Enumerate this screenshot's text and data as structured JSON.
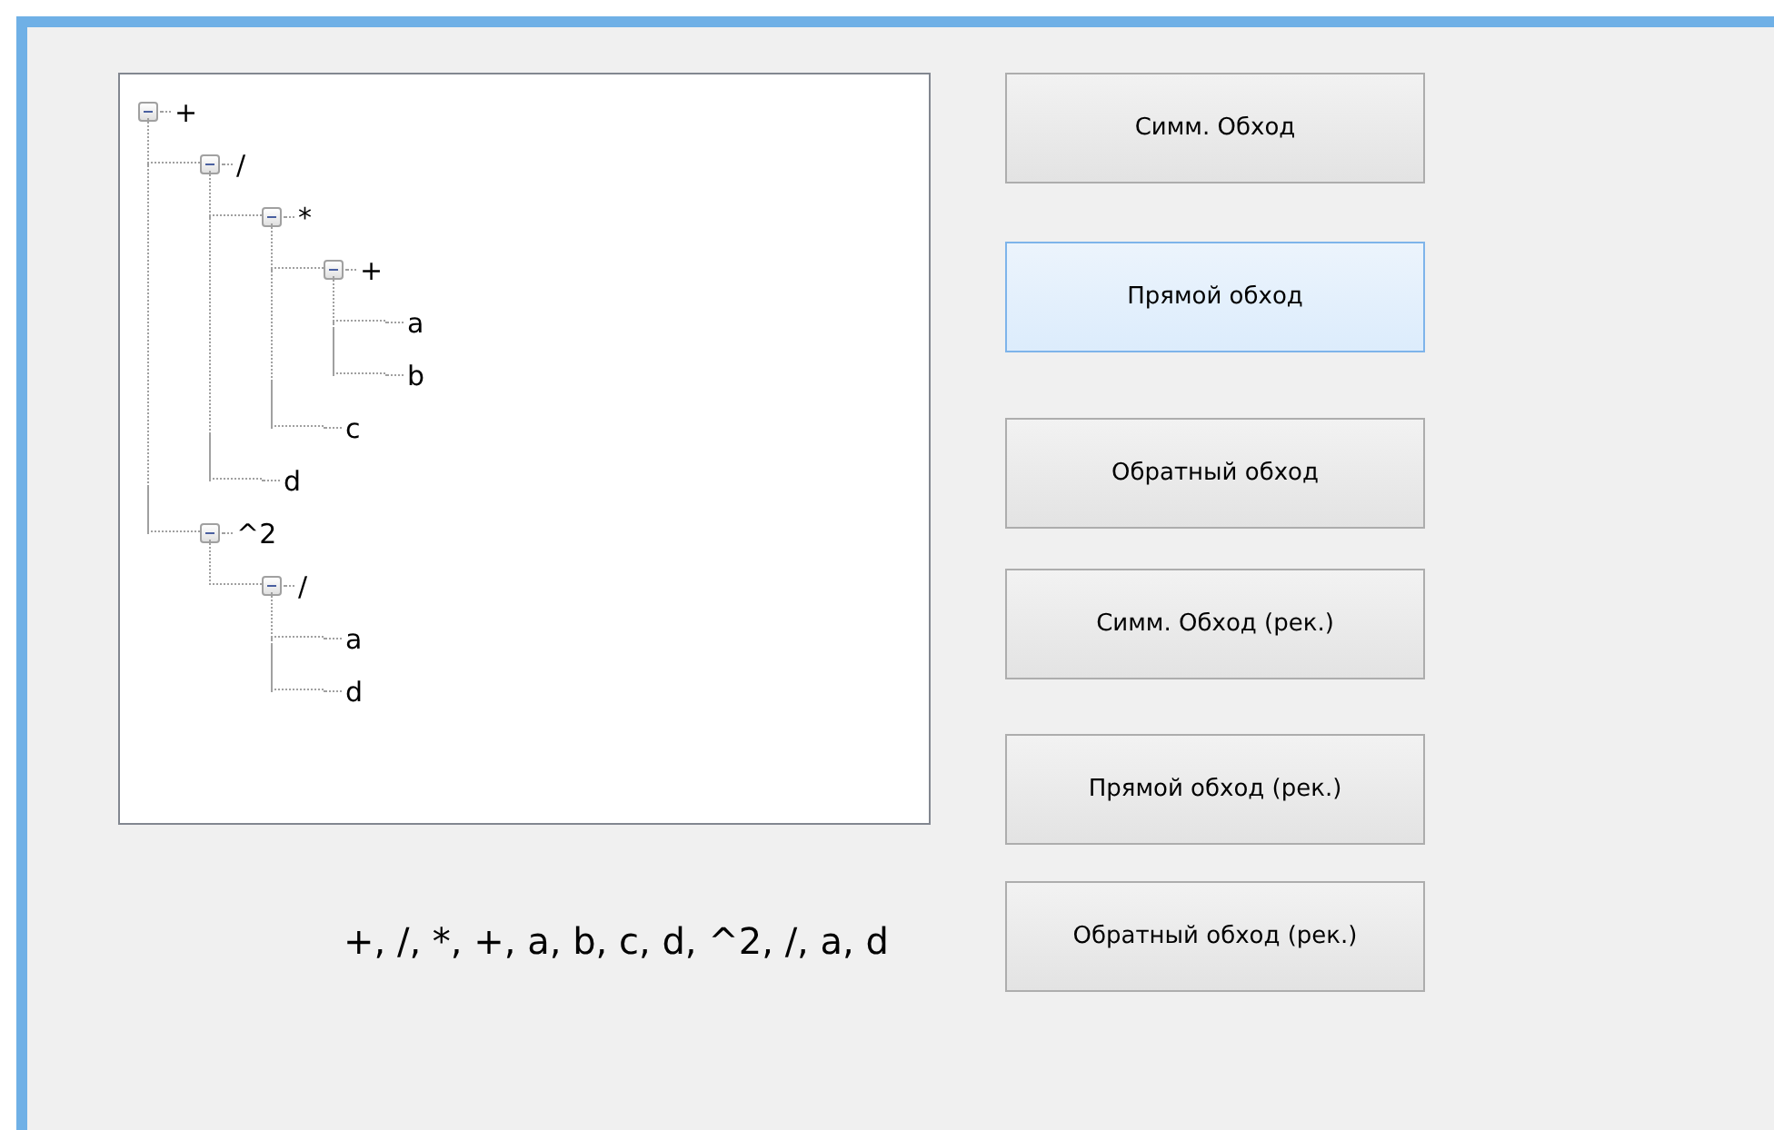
{
  "tree": [
    {
      "label": "+",
      "expanded": true,
      "children": [
        {
          "label": "/",
          "expanded": true,
          "children": [
            {
              "label": "*",
              "expanded": true,
              "children": [
                {
                  "label": "+",
                  "expanded": true,
                  "children": [
                    {
                      "label": "a"
                    },
                    {
                      "label": "b"
                    }
                  ]
                },
                {
                  "label": "c"
                }
              ]
            },
            {
              "label": "d"
            }
          ]
        },
        {
          "label": "^2",
          "expanded": true,
          "children": [
            {
              "label": "/",
              "expanded": true,
              "children": [
                {
                  "label": "a"
                },
                {
                  "label": "d"
                }
              ]
            }
          ]
        }
      ]
    }
  ],
  "buttons": [
    {
      "label": "Симм. Обход",
      "selected": false
    },
    {
      "label": "Прямой обход",
      "selected": true
    },
    {
      "label": "Обратный обход",
      "selected": false
    },
    {
      "label": "Симм. Обход (рек.)",
      "selected": false
    },
    {
      "label": "Прямой обход (рек.)",
      "selected": false
    },
    {
      "label": "Обратный обход (рек.)",
      "selected": false
    }
  ],
  "result": "+, /, *, +, a, b, c, d, ^2, /, a, d"
}
